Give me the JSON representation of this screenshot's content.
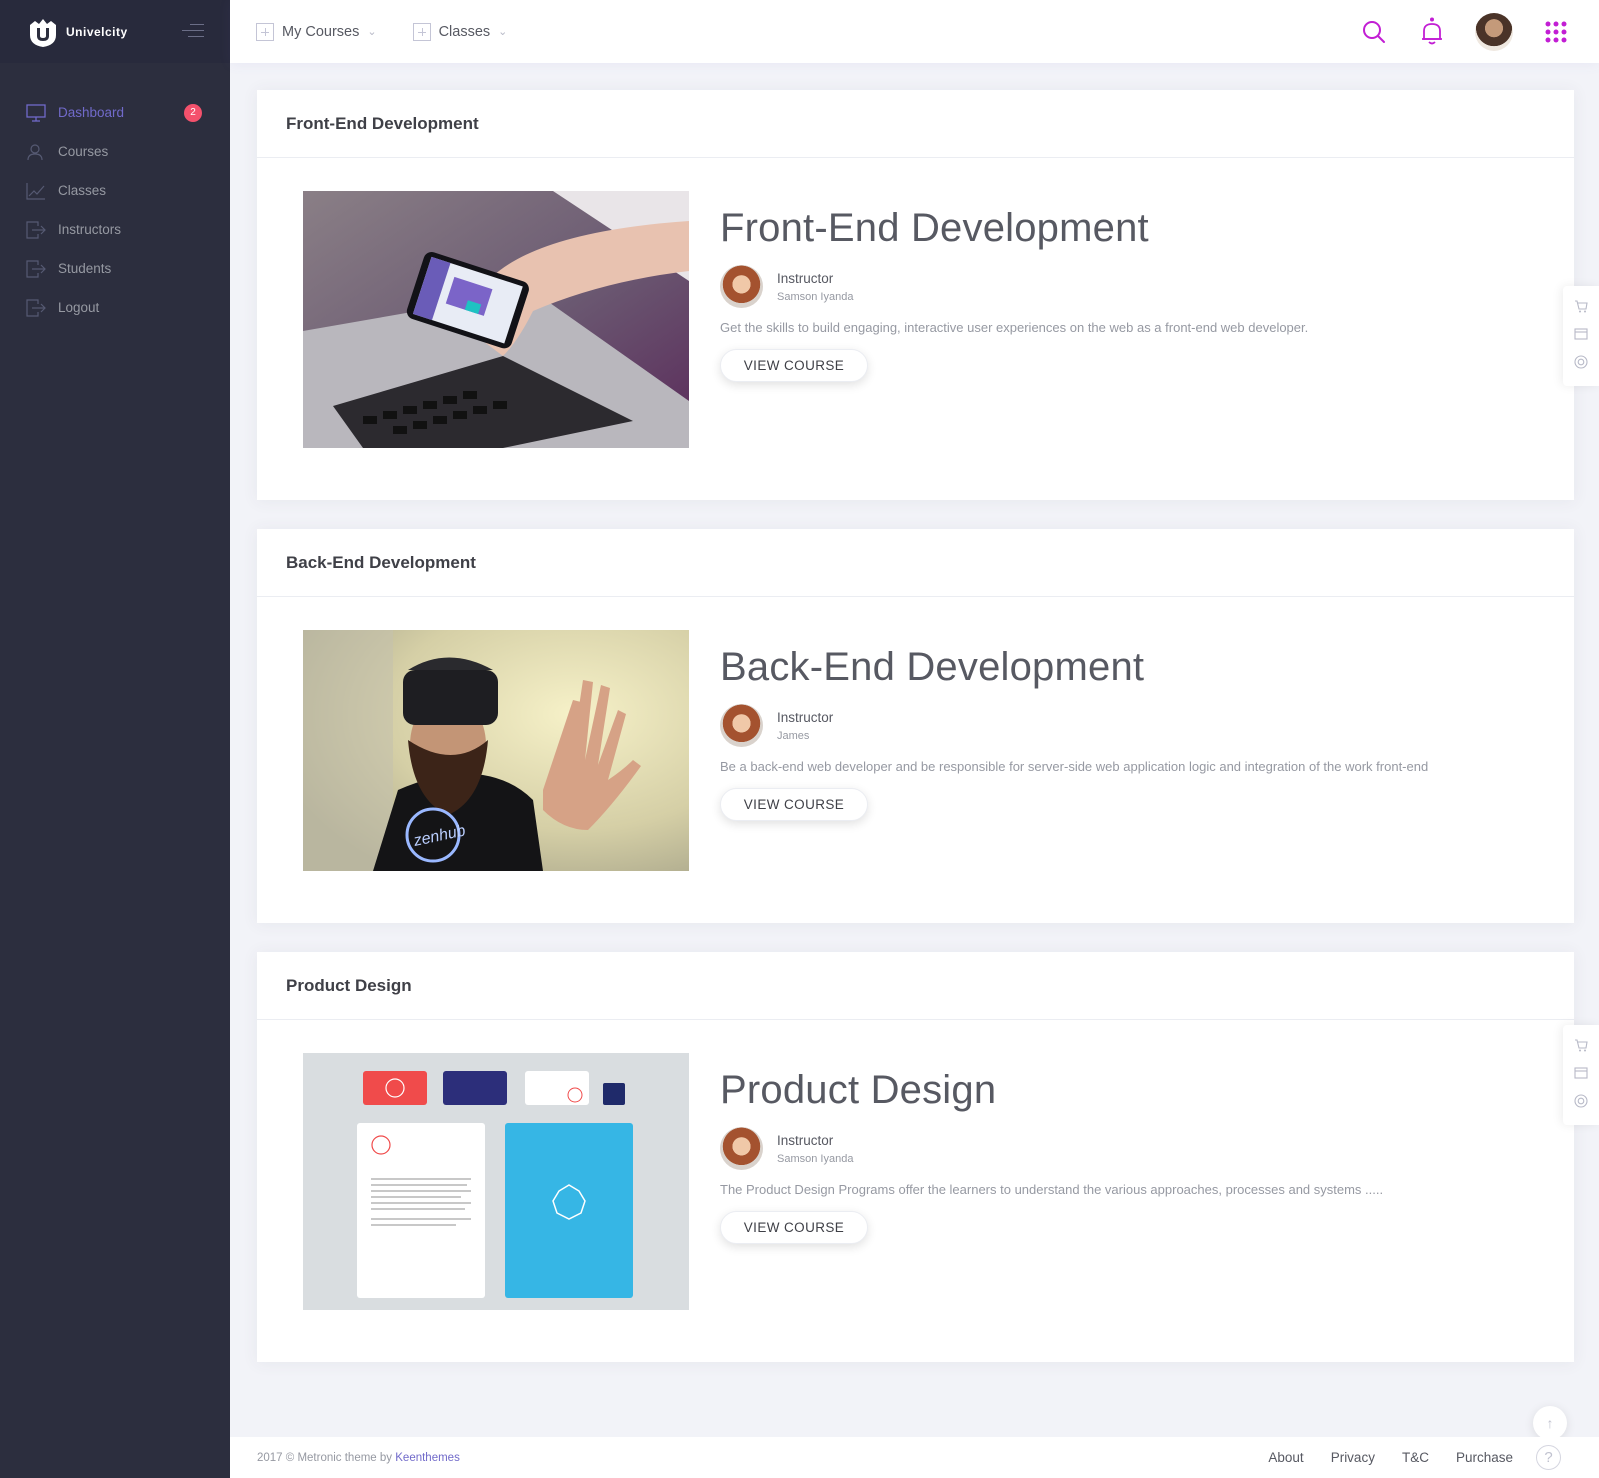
{
  "brand": {
    "name": "Univelcity"
  },
  "sidebar": {
    "items": [
      {
        "label": "Dashboard",
        "icon": "monitor-icon",
        "badge": "2",
        "active": true
      },
      {
        "label": "Courses",
        "icon": "users-icon"
      },
      {
        "label": "Classes",
        "icon": "chart-icon"
      },
      {
        "label": "Instructors",
        "icon": "logout-icon"
      },
      {
        "label": "Students",
        "icon": "logout-icon"
      },
      {
        "label": "Logout",
        "icon": "logout-icon"
      }
    ]
  },
  "header": {
    "nav": [
      {
        "label": "My Courses"
      },
      {
        "label": "Classes"
      }
    ]
  },
  "courses": [
    {
      "section_title": "Front-End Development",
      "title": "Front-End Development",
      "instructor_label": "Instructor",
      "instructor_name": "Samson Iyanda",
      "description": "Get the skills to build engaging, interactive user experiences on the web as a front-end web developer.",
      "button": "VIEW COURSE"
    },
    {
      "section_title": "Back-End Development",
      "title": "Back-End Development",
      "instructor_label": "Instructor",
      "instructor_name": "James",
      "description": "Be a back-end web developer and be responsible for server-side web application logic and integration of the work front-end",
      "button": "VIEW COURSE"
    },
    {
      "section_title": "Product Design",
      "title": "Product Design",
      "instructor_label": "Instructor",
      "instructor_name": "Samson Iyanda",
      "description": "The Product Design Programs offer the learners to understand the various approaches, processes and systems .....",
      "button": "VIEW COURSE"
    }
  ],
  "footer": {
    "copy_prefix": "2017 © Metronic theme by",
    "copy_link": "Keenthemes",
    "links": [
      "About",
      "Privacy",
      "T&C",
      "Purchase"
    ],
    "help": "?"
  },
  "colors": {
    "accent": "#716aca",
    "pink": "#c21ed4",
    "badge": "#f4516c",
    "sidebar": "#2c2e3e"
  }
}
